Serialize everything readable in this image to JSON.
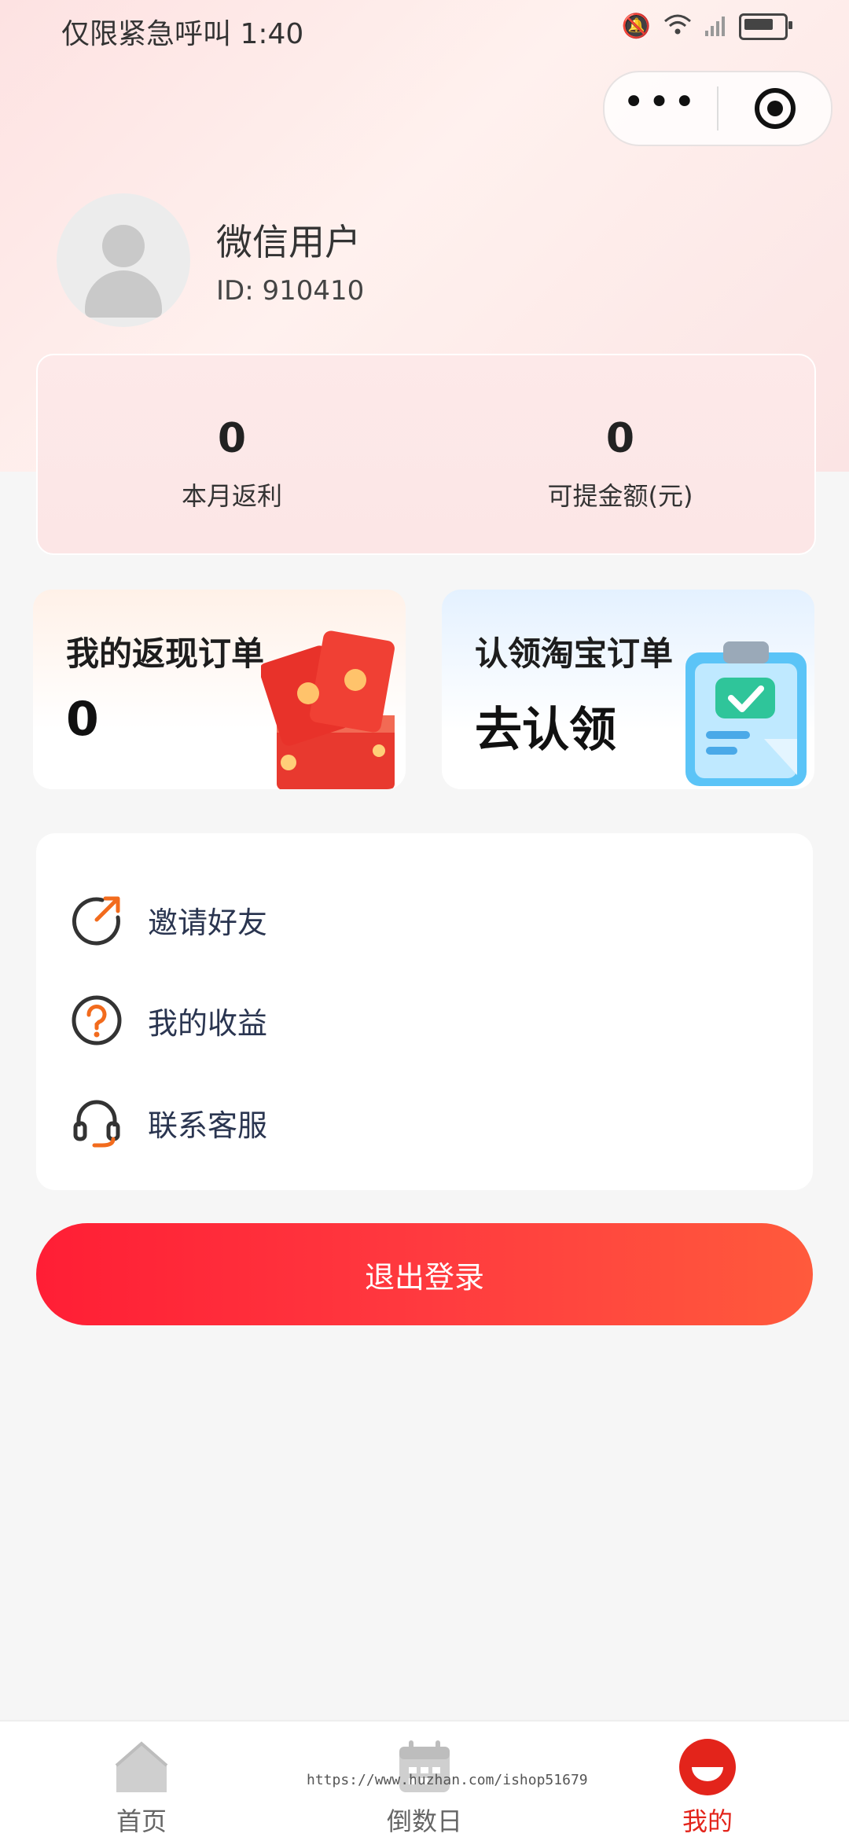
{
  "status_bar": {
    "left_text": "仅限紧急呼叫 1:40"
  },
  "capsule": {
    "more_label": "•••"
  },
  "profile": {
    "name": "微信用户",
    "id_text": "ID:  910410"
  },
  "stats": [
    {
      "value": "0",
      "label": "本月返利"
    },
    {
      "value": "0",
      "label": "可提金额(元)"
    }
  ],
  "promo_cards": {
    "left": {
      "title": "我的返现订单",
      "value": "0"
    },
    "right": {
      "title": "认领淘宝订单",
      "cta": "去认领"
    }
  },
  "menu": [
    {
      "label": "邀请好友",
      "icon": "invite-icon"
    },
    {
      "label": "我的收益",
      "icon": "question-icon"
    },
    {
      "label": "联系客服",
      "icon": "headset-icon"
    }
  ],
  "logout_label": "退出登录",
  "tabbar": [
    {
      "label": "首页",
      "icon": "home-icon"
    },
    {
      "label": "倒数日",
      "icon": "calendar-icon"
    },
    {
      "label": "我的",
      "icon": "profile-icon",
      "active": true
    }
  ],
  "watermark": "https://www.huzhan.com/ishop51679",
  "colors": {
    "accent": "#e3241b",
    "logout_gradient_start": "#ff1e35",
    "logout_gradient_end": "#ff5a3c"
  }
}
